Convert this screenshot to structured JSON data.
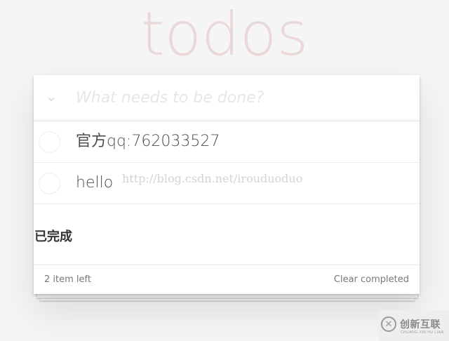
{
  "app": {
    "title": "todos"
  },
  "new_todo": {
    "toggle_icon": "chevron-down-icon",
    "placeholder": "What needs to be done?",
    "value": ""
  },
  "todos": [
    {
      "label": "官方qq:762033527",
      "completed": false
    },
    {
      "label": "hello",
      "completed": false
    }
  ],
  "watermark": {
    "url": "http://blog.csdn.net/irouduoduo"
  },
  "completed_section": {
    "title": "已完成"
  },
  "footer": {
    "count_text": "2 item left",
    "clear_label": "Clear completed"
  },
  "brand": {
    "name": "创新互联",
    "sub": "CHUANG XIN HU LIAN",
    "icon": "brand-logo-icon"
  },
  "colors": {
    "title": "#e8d0d0",
    "background": "#f5f5f5",
    "text": "#4d4d4d",
    "placeholder": "#e6e6e6"
  }
}
